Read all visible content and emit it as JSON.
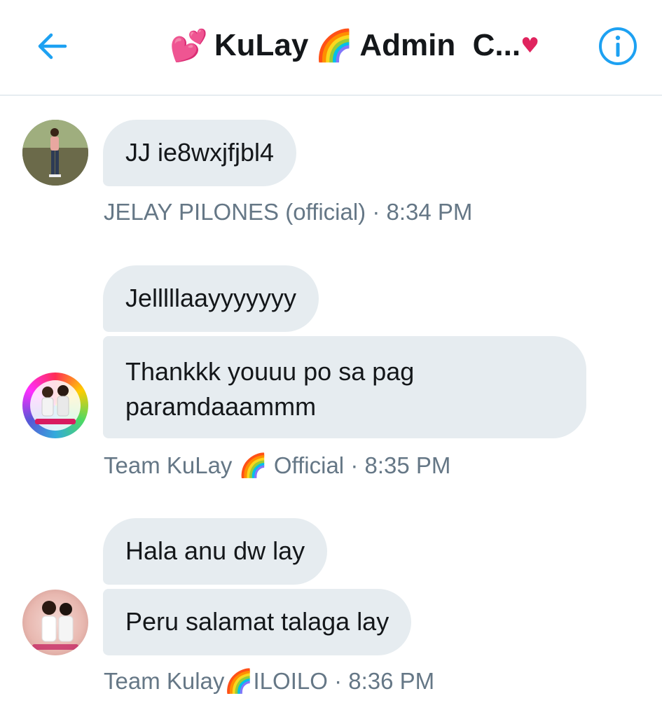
{
  "header": {
    "title_prefix_emoji": "💕",
    "title_part1": "KuLay",
    "title_emoji": "🌈",
    "title_part2": "Admin  C...",
    "title_suffix_emoji": "♥",
    "back_icon": "back-arrow-icon",
    "info_icon": "info-icon"
  },
  "colors": {
    "accent": "#1da1f2",
    "bubble": "#e6ecf0",
    "meta_text": "#657786",
    "text": "#14171a"
  },
  "messages": [
    {
      "bubbles": [
        "JJ ie8wxjfjbl4"
      ],
      "sender": "JELAY PILONES (official)",
      "time": "8:34 PM"
    },
    {
      "bubbles": [
        "Jelllllaayyyyyyy",
        "Thankkk youuu po sa pag paramdaaammm"
      ],
      "sender_part1": "Team KuLay",
      "sender_emoji": "🌈",
      "sender_part2": "Official",
      "time": "8:35 PM"
    },
    {
      "bubbles": [
        "Hala anu dw lay",
        "Peru salamat talaga lay"
      ],
      "sender_part1": "Team Kulay",
      "sender_emoji": "🌈",
      "sender_part2": "ILOILO",
      "time": "8:36 PM"
    }
  ],
  "separator": "·"
}
